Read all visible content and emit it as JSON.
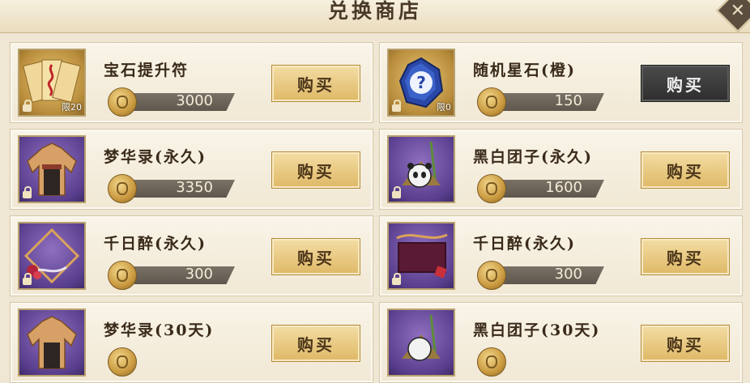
{
  "title": "兑换商店",
  "buy_label": "购买",
  "items": [
    {
      "name": "宝石提升符",
      "price": "3000",
      "limit": "限20",
      "thumb": "talisman-scrolls-icon",
      "bg": "gold",
      "buy_style": "gold"
    },
    {
      "name": "随机星石(橙)",
      "price": "150",
      "limit": "限0",
      "thumb": "blue-gem-question-icon",
      "bg": "gold",
      "buy_style": "dark"
    },
    {
      "name": "梦华录(永久)",
      "price": "3350",
      "limit": "",
      "thumb": "robe-costume-icon",
      "bg": "purple",
      "buy_style": "gold"
    },
    {
      "name": "黑白团子(永久)",
      "price": "1600",
      "limit": "",
      "thumb": "panda-bamboo-icon",
      "bg": "purple",
      "buy_style": "gold"
    },
    {
      "name": "千日醉(永久)",
      "price": "300",
      "limit": "",
      "thumb": "frame-ribbon-icon",
      "bg": "purple",
      "buy_style": "gold"
    },
    {
      "name": "千日醉(永久)",
      "price": "300",
      "limit": "",
      "thumb": "wine-banner-icon",
      "bg": "purple",
      "buy_style": "gold"
    },
    {
      "name": "梦华录(30天)",
      "price": "",
      "limit": "",
      "thumb": "robe-costume-icon",
      "bg": "purple",
      "buy_style": "gold"
    },
    {
      "name": "黑白团子(30天)",
      "price": "",
      "limit": "",
      "thumb": "panda-bamboo-icon",
      "bg": "purple",
      "buy_style": "gold"
    }
  ]
}
